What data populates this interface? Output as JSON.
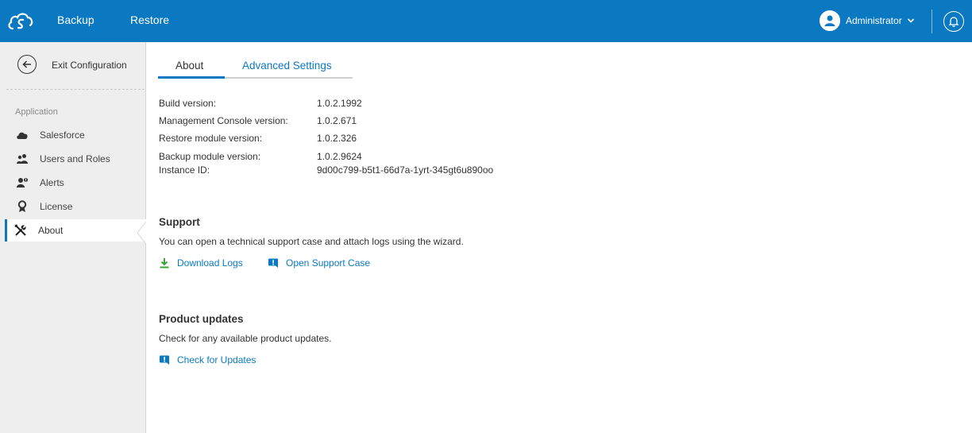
{
  "topbar": {
    "logo_icon": "cloud-backup-logo-icon",
    "nav": [
      {
        "label": "Backup"
      },
      {
        "label": "Restore"
      }
    ],
    "user_name": "Administrator",
    "user_icon": "user-avatar-icon",
    "bell_icon": "bell-icon",
    "colors": {
      "bar": "#0a79c2"
    }
  },
  "sidebar": {
    "exit_label": "Exit Configuration",
    "section_label": "Application",
    "items": [
      {
        "label": "Salesforce",
        "icon": "cloud-icon"
      },
      {
        "label": "Users and Roles",
        "icon": "users-icon"
      },
      {
        "label": "Alerts",
        "icon": "alert-icon"
      },
      {
        "label": "License",
        "icon": "license-icon"
      },
      {
        "label": "About",
        "icon": "tools-icon",
        "active": true
      }
    ]
  },
  "tabs": {
    "about": "About",
    "advanced": "Advanced Settings",
    "active": "About"
  },
  "about_info": [
    {
      "key": "Build version:",
      "value": "1.0.2.1992"
    },
    {
      "key": "Management Console version:",
      "value": "1.0.2.671"
    },
    {
      "key": "Restore module version:",
      "value": "1.0.2.326"
    },
    {
      "key": "Backup module version:",
      "value": "1.0.2.9624"
    },
    {
      "key": "Instance ID:",
      "value": "9d00c799-b5t1-66d7a-1yrt-345gt6u890oo"
    }
  ],
  "support": {
    "title": "Support",
    "description": "You can open a technical support case and attach logs using the wizard.",
    "download_logs": "Download Logs",
    "open_case": "Open Support Case"
  },
  "updates": {
    "title": "Product updates",
    "description": "Check for any available product updates.",
    "check": "Check for Updates"
  }
}
